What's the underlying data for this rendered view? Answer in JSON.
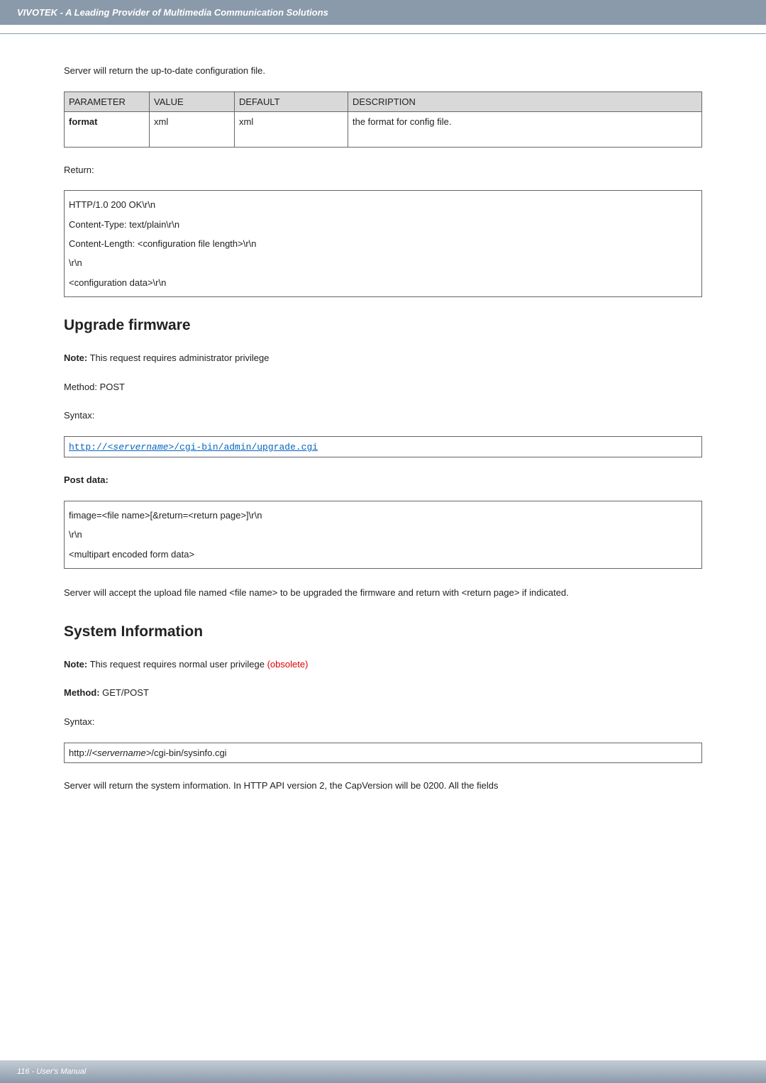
{
  "header": {
    "title": "VIVOTEK - A Leading Provider of Multimedia Communication Solutions"
  },
  "intro": "Server will return the up-to-date configuration file.",
  "paramTable": {
    "headers": {
      "c0": "PARAMETER",
      "c1": "VALUE",
      "c2": "DEFAULT",
      "c3": "DESCRIPTION"
    },
    "row": {
      "c0": "format",
      "c1": "xml",
      "c2": "xml",
      "c3": "the format for config file."
    }
  },
  "returnLabel": "Return:",
  "returnBox": {
    "l0": "HTTP/1.0 200 OK\\r\\n",
    "l1": "Content-Type: text/plain\\r\\n",
    "l2": "Content-Length: <configuration file length>\\r\\n",
    "l3": "\\r\\n",
    "l4": "<configuration data>\\r\\n"
  },
  "upgrade": {
    "heading": "Upgrade firmware",
    "noteLabel": "Note:",
    "noteText": " This request requires administrator privilege",
    "method": "Method: POST",
    "syntaxLabel": "Syntax:",
    "url_pre": "http://<",
    "url_svr": "servername",
    "url_post": ">/cgi-bin/admin/upgrade.cgi",
    "postDataLabel": "Post data:",
    "postBox": {
      "l0": "fimage=<file name>[&return=<return page>]\\r\\n",
      "l1": "\\r\\n",
      "l2": "<multipart encoded form data>"
    },
    "postText": "Server will accept the upload file named <file name> to be upgraded the firmware and return with <return page> if indicated."
  },
  "sysinfo": {
    "heading": "System Information",
    "noteLabel": "Note:",
    "noteText": " This request requires normal user privilege ",
    "obsolete": "(obsolete)",
    "methodLabel": "Method:",
    "methodText": " GET/POST",
    "syntaxLabel": "Syntax:",
    "url_pre": "http://",
    "url_svr": "<servername>",
    "url_post": "/cgi-bin/sysinfo.cgi",
    "footText": "Server will return the system information. In HTTP API version 2, the CapVersion will be 0200. All the fields"
  },
  "footer": {
    "text": "116 - User's Manual"
  }
}
